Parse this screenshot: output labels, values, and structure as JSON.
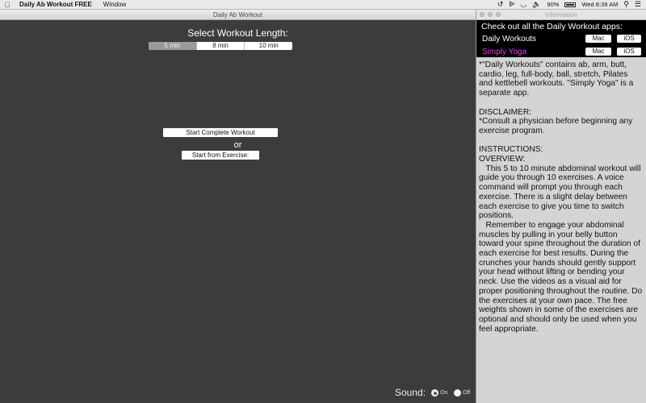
{
  "menubar": {
    "apple": "",
    "app_name": "Daily Ab Workout FREE",
    "menus": [
      "Window"
    ],
    "battery": "90%",
    "time": "Wed 8:39 AM"
  },
  "main_window": {
    "title": "Daily Ab Workout",
    "select_title": "Select Workout Length:",
    "lengths": [
      "5 min",
      "8 min",
      "10 min"
    ],
    "selected_length": "5 min",
    "start_complete_label": "Start Complete Workout",
    "or_label": "or",
    "start_from_label": "Start from Exercise:",
    "sound_label": "Sound:",
    "sound_on": "On",
    "sound_off": "Off",
    "sound_selected": "On"
  },
  "info_panel": {
    "title": "Information",
    "apps_heading": "Check out all the Daily Workout apps:",
    "apps": [
      {
        "name": "Daily Workouts",
        "mac": "Mac",
        "ios": "iOS",
        "color": "#ffffff"
      },
      {
        "name": "Simply Yoga",
        "mac": "Mac",
        "ios": "iOS",
        "color": "#e23ee6"
      }
    ],
    "intro": "*\"Daily Workouts\" contains ab, arm, butt, cardio, leg, full-body, ball, stretch, Pilates and kettlebell workouts. \"Simply Yoga\" is a separate app.",
    "disclaimer_heading": "DISCLAIMER:",
    "disclaimer": "*Consult a physician before beginning any exercise program.",
    "instructions_heading": "INSTRUCTIONS:",
    "overview_heading": "OVERVIEW:",
    "para1": "   This 5 to 10 minute abdominal workout will guide you through 10 exercises. A voice command will prompt you through each exercise. There is a slight delay between each exercise to give you time to switch positions.",
    "para2": "   Remember to engage your abdominal muscles by pulling in your belly button toward your spine throughout the duration of each exercise for best results. During the crunches your hands should gently support your head without lifting or bending your neck. Use the videos as a visual aid for proper positioning throughout the routine. Do the exercises at your own pace. The free weights shown in some of the exercises are optional and should only be used when you feel appropriate."
  }
}
